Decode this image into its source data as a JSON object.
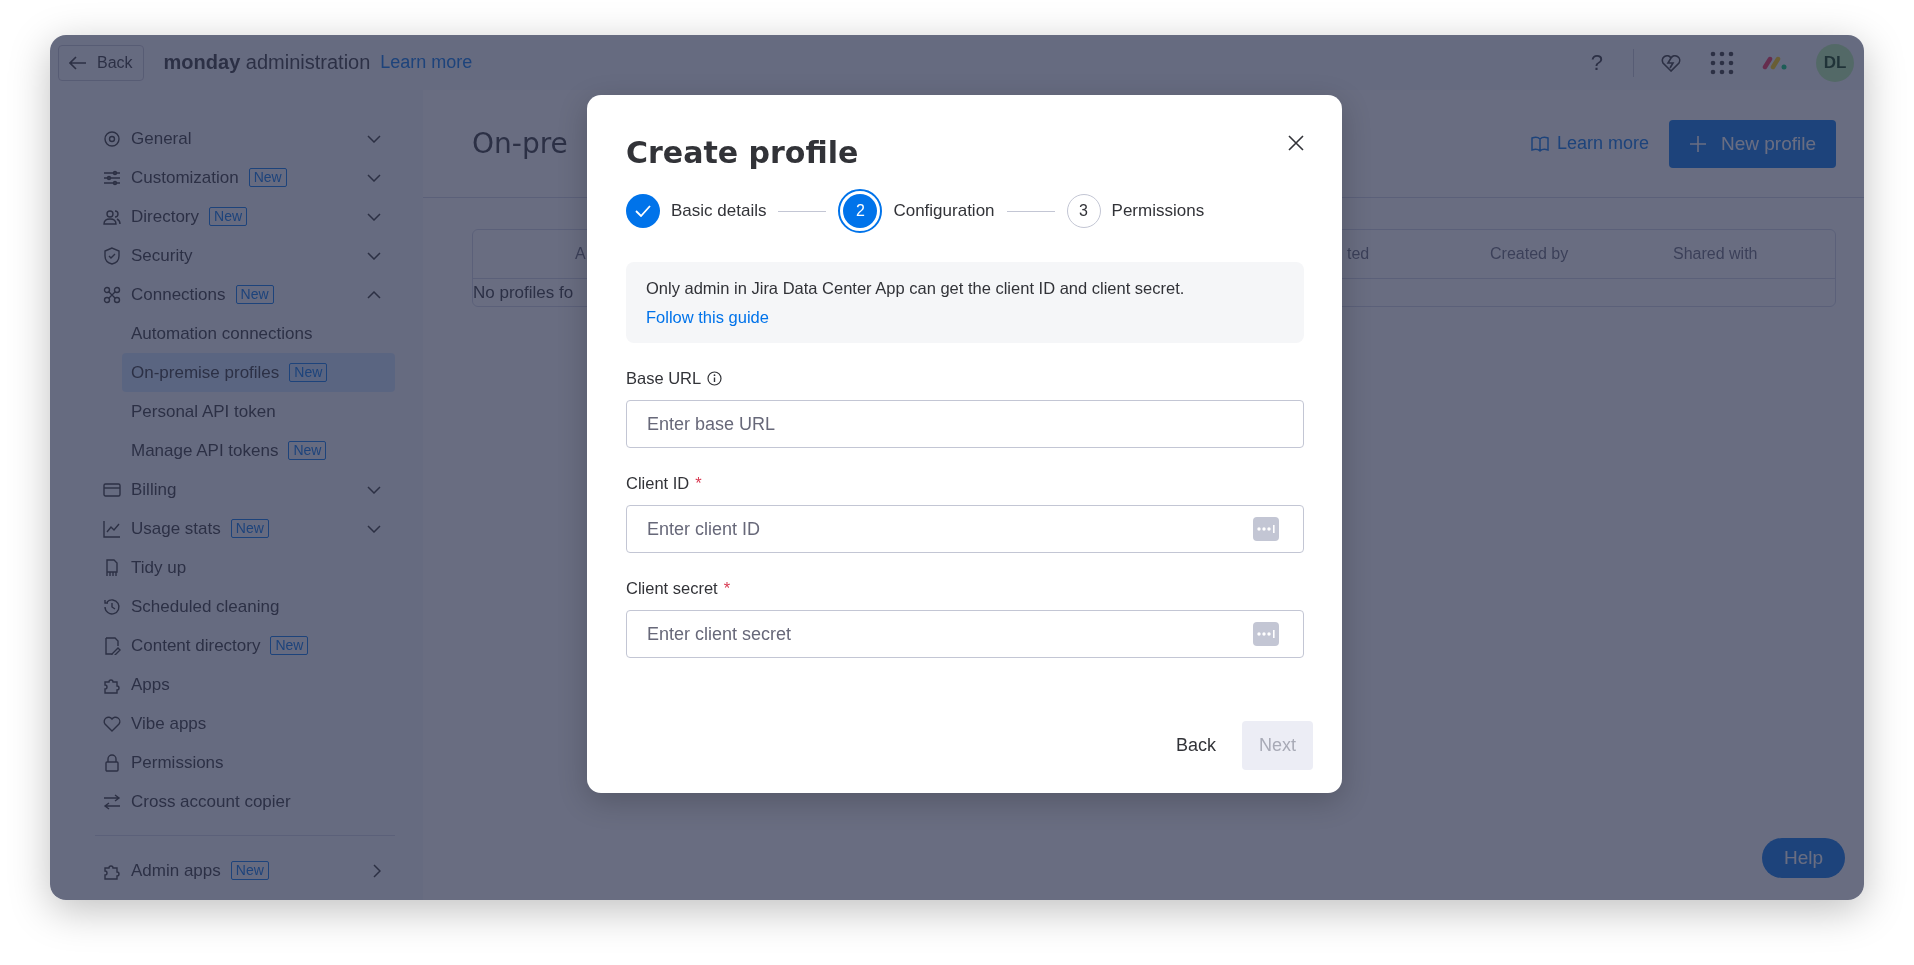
{
  "topbar": {
    "back_button": "Back",
    "brand_bold": "monday",
    "brand_rest": "administration",
    "learn_more": "Learn more",
    "help_glyph": "?",
    "avatar": "DL"
  },
  "sidebar": {
    "items": [
      {
        "label": "General",
        "kind": "expandable",
        "expanded": false,
        "selected": false
      },
      {
        "label": "Customization",
        "badge": "New",
        "kind": "expandable",
        "expanded": false,
        "selected": false
      },
      {
        "label": "Directory",
        "badge": "New",
        "kind": "expandable",
        "expanded": false,
        "selected": false
      },
      {
        "label": "Security",
        "kind": "expandable",
        "expanded": false,
        "selected": false
      },
      {
        "label": "Connections",
        "badge": "New",
        "kind": "expandable",
        "expanded": true,
        "selected": false,
        "children": [
          {
            "label": "Automation connections",
            "selected": false
          },
          {
            "label": "On-premise profiles",
            "badge": "New",
            "selected": true
          },
          {
            "label": "Personal API token",
            "selected": false
          },
          {
            "label": "Manage API tokens",
            "badge": "New",
            "selected": false
          }
        ]
      },
      {
        "label": "Billing",
        "kind": "expandable",
        "expanded": false,
        "selected": false
      },
      {
        "label": "Usage stats",
        "badge": "New",
        "kind": "expandable",
        "expanded": false,
        "selected": false
      },
      {
        "label": "Tidy up",
        "kind": "page",
        "selected": false
      },
      {
        "label": "Scheduled cleaning",
        "kind": "page",
        "selected": false
      },
      {
        "label": "Content directory",
        "badge": "New",
        "kind": "page",
        "selected": false
      },
      {
        "label": "Apps",
        "kind": "page",
        "selected": false
      },
      {
        "label": "Vibe apps",
        "kind": "page",
        "selected": false
      },
      {
        "label": "Permissions",
        "kind": "page",
        "selected": false
      },
      {
        "label": "Cross account copier",
        "kind": "page",
        "selected": false
      }
    ],
    "footer_items": [
      {
        "label": "Admin apps",
        "badge": "New",
        "kind": "link",
        "selected": false
      }
    ]
  },
  "main": {
    "page_title": "On-pre",
    "learn_more": "Learn more",
    "new_profile_button": "New profile",
    "table": {
      "columns": [
        "A",
        "ted",
        "Created by",
        "Shared with"
      ],
      "empty_message": "No profiles fo"
    }
  },
  "modal": {
    "title": "Create profile",
    "steps": [
      {
        "label": "Basic details",
        "completed": true,
        "selected": false
      },
      {
        "number": "2",
        "label": "Configuration",
        "completed": false,
        "selected": true
      },
      {
        "number": "3",
        "label": "Permissions",
        "completed": false,
        "selected": false
      }
    ],
    "notice": {
      "text": "Only admin in Jira Data Center App can get the client ID and client secret.",
      "link": "Follow this guide"
    },
    "fields": [
      {
        "label": "Base URL",
        "placeholder": "Enter base URL",
        "info": true,
        "kind": "text"
      },
      {
        "label": "Client ID",
        "required_mark": "*",
        "placeholder": "Enter client ID",
        "info": false,
        "kind": "secret"
      },
      {
        "label": "Client secret",
        "required_mark": "*",
        "placeholder": "Enter client secret",
        "info": false,
        "kind": "secret"
      }
    ],
    "back_button": "Back",
    "next_button": {
      "label": "Next",
      "disabled": true
    }
  },
  "help_button": "Help"
}
